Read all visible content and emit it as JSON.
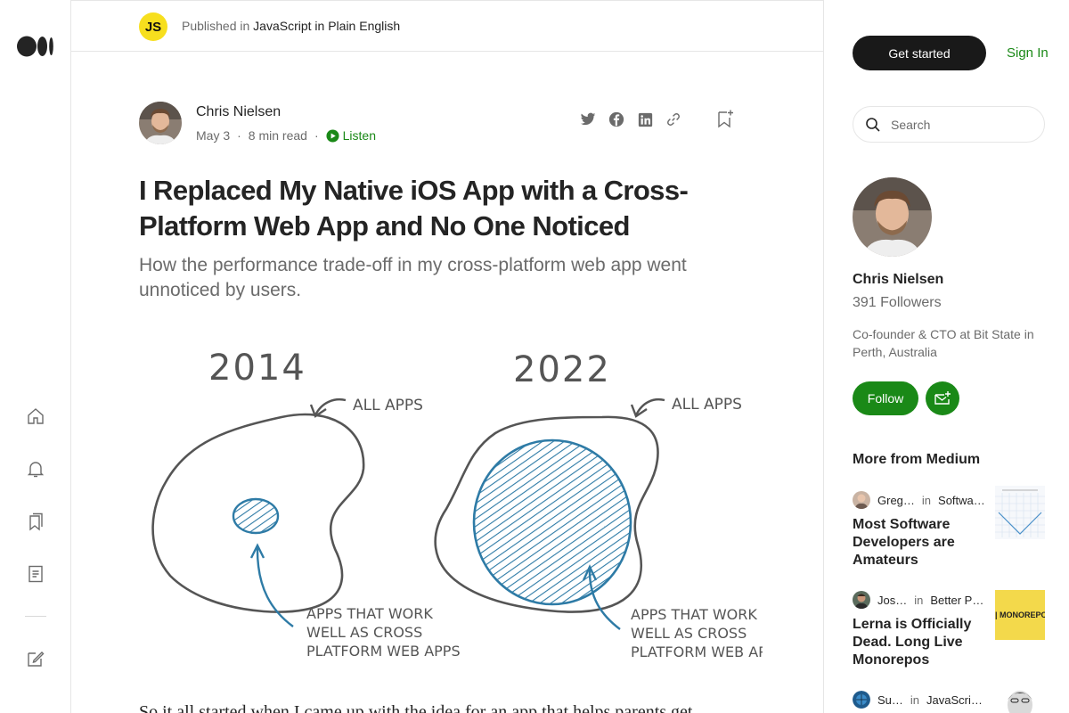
{
  "publication": {
    "logo_text": "JS",
    "published_in": "Published in",
    "name": "JavaScript in Plain English"
  },
  "article": {
    "author": "Chris Nielsen",
    "date": "May 3",
    "separator": "·",
    "read_time": "8 min read",
    "listen": "Listen",
    "title": "I Replaced My Native iOS App with a Cross-Platform Web App and No One Noticed",
    "subtitle": "How the performance trade-off in my cross-platform web app went unnoticed by users.",
    "body_start": "So it all started when I came up with the idea for an app that helps parents get"
  },
  "hero": {
    "year_left": "2014",
    "year_right": "2022",
    "label_all_apps": "All apps",
    "label_cross_line1": "Apps that work",
    "label_cross_line2": "well as cross",
    "label_cross_line3": "platform web apps",
    "blue": "#2e7ba6",
    "ink": "#555555"
  },
  "share": {
    "icons": [
      "twitter-icon",
      "facebook-icon",
      "linkedin-icon",
      "link-icon"
    ],
    "save": "bookmark-add-icon"
  },
  "sidebar": {
    "get_started": "Get started",
    "sign_in": "Sign In",
    "search_placeholder": "Search",
    "author_name": "Chris Nielsen",
    "followers": "391 Followers",
    "bio": "Co-founder & CTO at Bit State in Perth, Australia",
    "follow": "Follow",
    "more_heading": "More from Medium",
    "recommendations": [
      {
        "author": "Greg…",
        "in": "in",
        "publication": "Softwa…",
        "title": "Most Software Developers are Amateurs"
      },
      {
        "author": "Jos…",
        "in": "in",
        "publication": "Better P…",
        "title": "Lerna is Officially Dead. Long Live Monorepos"
      },
      {
        "author": "Su…",
        "in": "in",
        "publication": "JavaScri…",
        "title": ""
      }
    ],
    "thumb_text": "S | MONOREPOS"
  },
  "colors": {
    "accent_green": "#1a8917",
    "black_button": "#191919",
    "js_yellow": "#f7df1e",
    "muted_text": "#6b6b6b"
  }
}
